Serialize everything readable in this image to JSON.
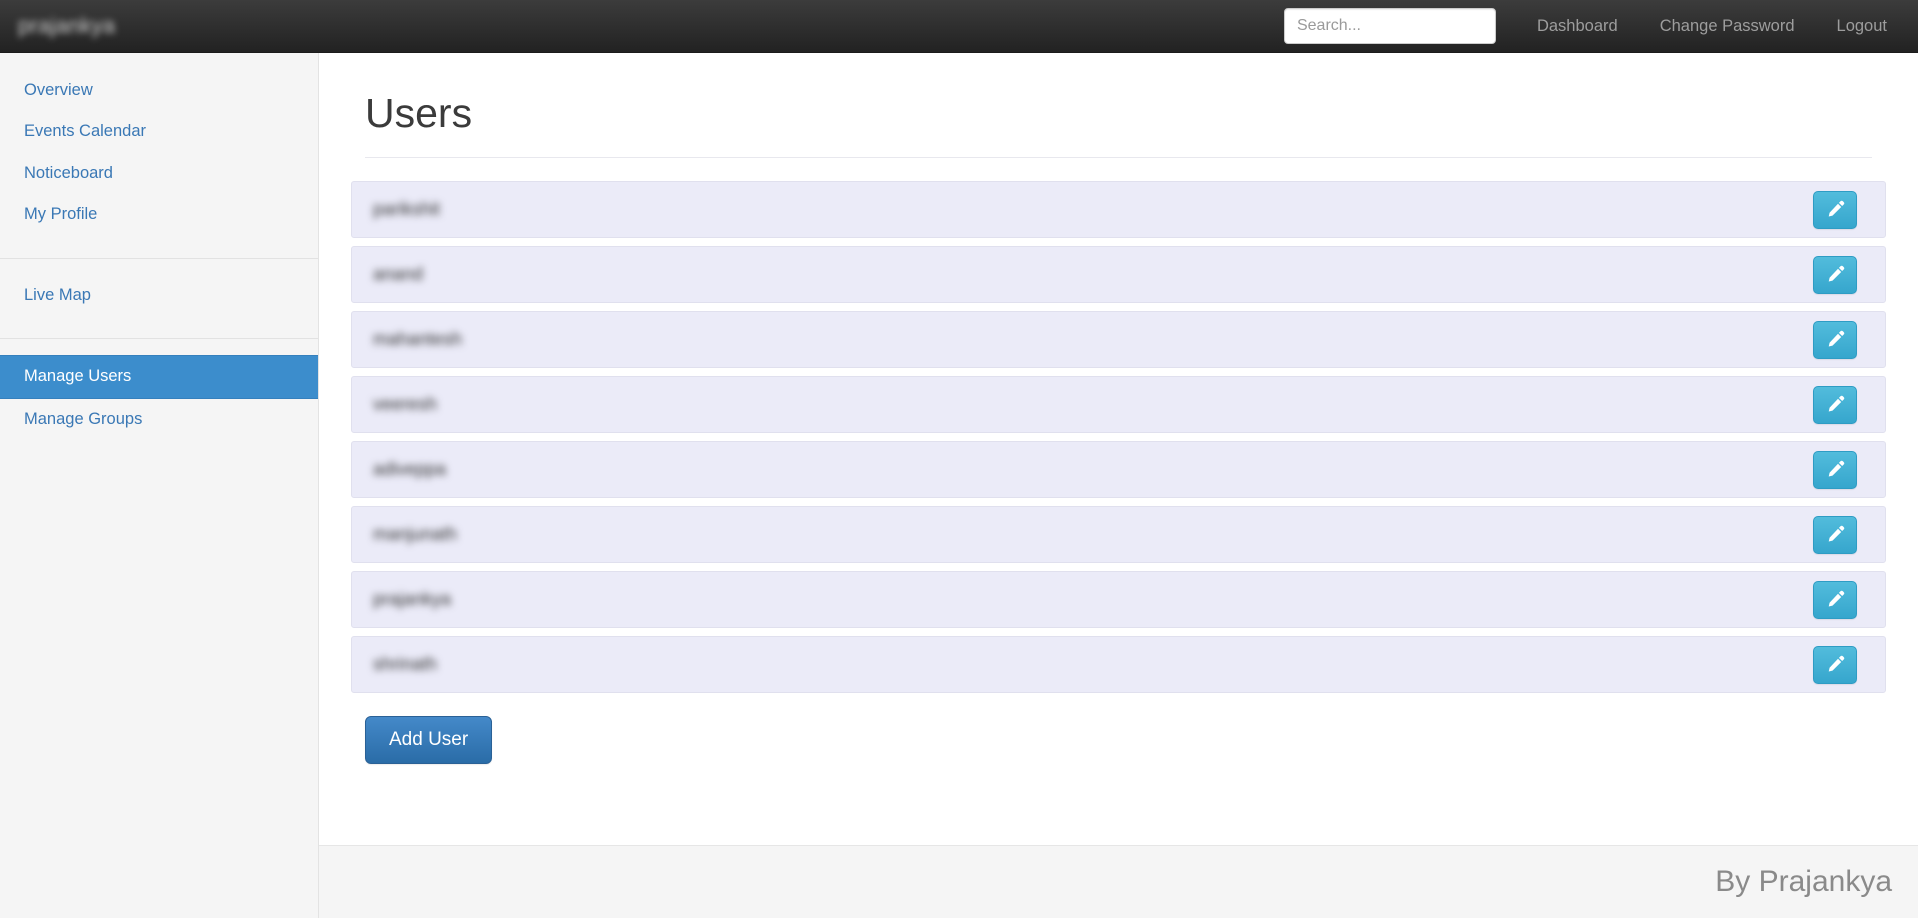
{
  "navbar": {
    "brand": "prajankya",
    "search": {
      "placeholder": "Search...",
      "value": ""
    },
    "links": [
      {
        "label": "Dashboard",
        "name": "nav-link-dashboard"
      },
      {
        "label": "Change Password",
        "name": "nav-link-change-password"
      },
      {
        "label": "Logout",
        "name": "nav-link-logout"
      }
    ]
  },
  "sidebar": {
    "groups": [
      {
        "items": [
          {
            "label": "Overview",
            "active": false
          },
          {
            "label": "Events Calendar",
            "active": false
          },
          {
            "label": "Noticeboard",
            "active": false
          },
          {
            "label": "My Profile",
            "active": false
          }
        ]
      },
      {
        "items": [
          {
            "label": "Live Map",
            "active": false
          }
        ]
      },
      {
        "items": [
          {
            "label": "Manage Users",
            "active": true
          },
          {
            "label": "Manage Groups",
            "active": false
          }
        ]
      }
    ]
  },
  "main": {
    "title": "Users",
    "users": [
      {
        "name": "parikshit",
        "edit_label": "Edit"
      },
      {
        "name": "anand",
        "edit_label": "Edit"
      },
      {
        "name": "mahantesh",
        "edit_label": "Edit"
      },
      {
        "name": "veeresh",
        "edit_label": "Edit"
      },
      {
        "name": "adiveppa",
        "edit_label": "Edit"
      },
      {
        "name": "manjunath",
        "edit_label": "Edit"
      },
      {
        "name": "prajankya",
        "edit_label": "Edit"
      },
      {
        "name": "shrinath",
        "edit_label": "Edit"
      }
    ],
    "add_user_label": "Add User"
  },
  "footer": {
    "text": "By Prajankya"
  },
  "colors": {
    "navbar_bg": "#222222",
    "sidebar_bg": "#f5f5f5",
    "sidebar_link": "#3a78b5",
    "sidebar_active_bg": "#3c8dcc",
    "row_bg": "#ebebf8",
    "edit_button": "#36a6cd",
    "add_button": "#2a6ca7",
    "footer_text": "#8a8a8a"
  }
}
